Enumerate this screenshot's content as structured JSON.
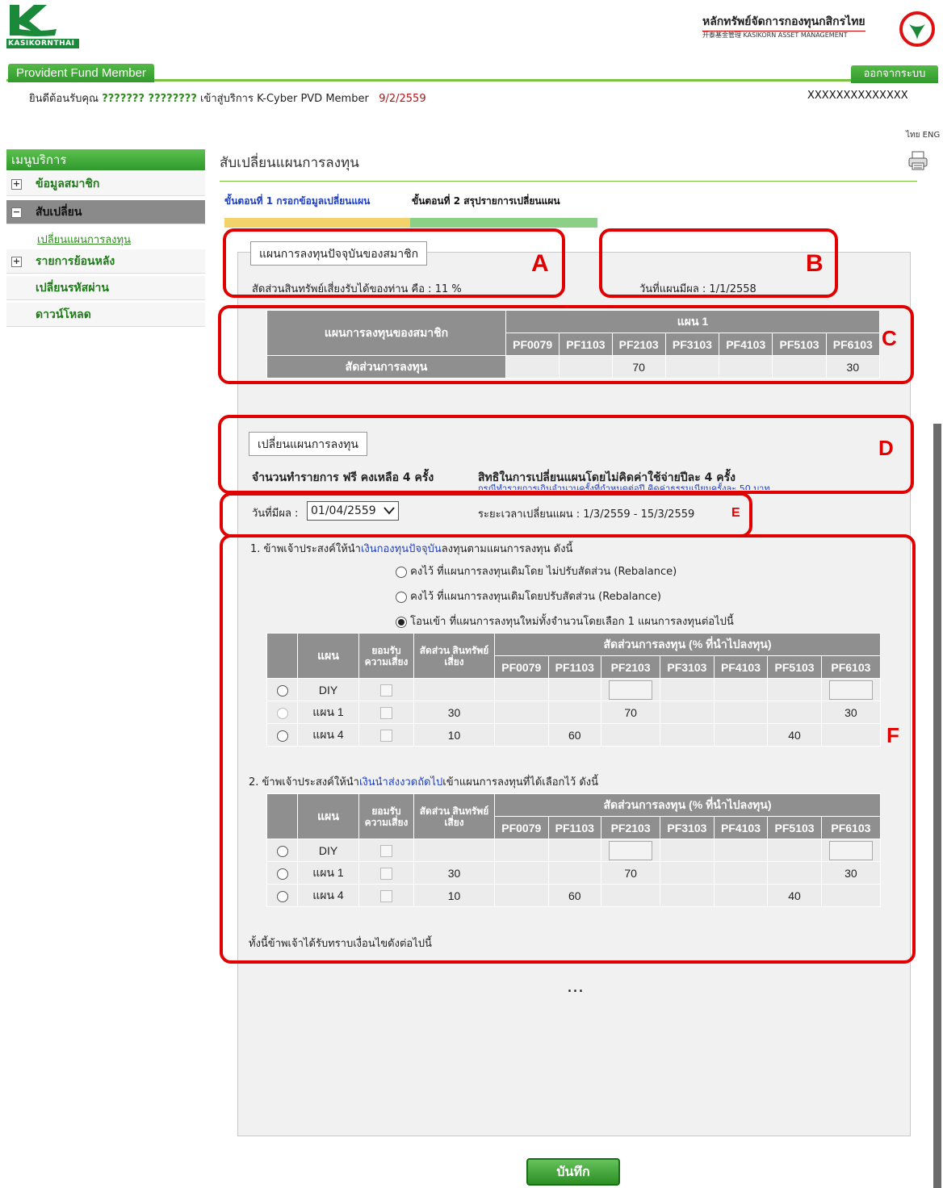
{
  "header": {
    "logo_text": "KASIKORNTHAI",
    "brand_th": "หลักทรัพย์จัดการกองทุนกสิกรไทย",
    "brand_en": "开泰基金管理 KASIKORN ASSET MANAGEMENT",
    "section_tab": "Provident Fund Member",
    "logout": "ออกจากระบบ",
    "welcome_prefix": "ยินดีต้อนรับคุณ",
    "welcome_name": "??????? ????????",
    "welcome_suffix": "เข้าสู่บริการ K-Cyber PVD Member",
    "welcome_date": "9/2/2559",
    "account": "XXXXXXXXXXXXXX",
    "lang": "ไทย ENG"
  },
  "sidebar": {
    "title": "เมนูบริการ",
    "items": [
      {
        "label": "ข้อมูลสมาชิก",
        "toggle": "+"
      },
      {
        "label": "สับเปลี่ยน",
        "toggle": "−"
      },
      {
        "label": "รายการย้อนหลัง",
        "toggle": "+"
      },
      {
        "label": "เปลี่ยนรหัสผ่าน",
        "toggle": ""
      },
      {
        "label": "ดาวน์โหลด",
        "toggle": ""
      }
    ],
    "sub_item": "เปลี่ยนแผนการลงทุน"
  },
  "main": {
    "title": "สับเปลี่ยนแผนการลงทุน",
    "step1": "ขั้นตอนที่ 1 กรอกข้อมูลเปลี่ยนแผน",
    "step2": "ขั้นตอนที่ 2 สรุปรายการเปลี่ยนแผน",
    "current": {
      "legend": "แผนการลงทุนปัจจุบันของสมาชิก",
      "risk_label": "สัดส่วนสินทรัพย์เสี่ยงรับได้ของท่าน คือ  :  11 %",
      "effective": "วันที่แผนมีผล :  1/1/2558",
      "table": {
        "row1": "แผนการลงทุนของสมาชิก",
        "row2": "สัดส่วนการลงทุน",
        "plan": "แผน 1",
        "funds": [
          "PF0079",
          "PF1103",
          "PF2103",
          "PF3103",
          "PF4103",
          "PF5103",
          "PF6103"
        ],
        "values": [
          "",
          "",
          "70",
          "",
          "",
          "",
          "30"
        ]
      }
    },
    "change": {
      "legend": "เปลี่ยนแผนการลงทุน",
      "free": "จำนวนทำรายการ ฟรี คงเหลือ 4 ครั้ง",
      "rights": "สิทธิในการเปลี่ยนแผนโดยไม่คิดค่าใช้จ่ายปีละ 4  ครั้ง",
      "note": "กรณีทำรายการเกินจำนวนครั้งที่กำหนดต่อปี คิดค่าธรรมเนียมครั้งละ 50 บาท",
      "eff_label": "วันที่มีผล :",
      "eff_value": "01/04/2559",
      "period": "ระยะเวลาเปลี่ยนแผน : 1/3/2559 - 15/3/2559"
    },
    "q1": {
      "pre": "1. ข้าพเจ้าประสงค์ให้นำ",
      "link": "เงินกองทุนปัจจุบัน",
      "post": "ลงทุนตามแผนการลงทุน ดังนี้",
      "options": [
        "คงไว้ ที่แผนการลงทุนเดิมโดย ไม่ปรับสัดส่วน (Rebalance)",
        "คงไว้ ที่แผนการลงทุนเดิมโดยปรับสัดส่วน (Rebalance)",
        "โอนเข้า ที่แผนการลงทุนใหม่ทั้งจำนวนโดยเลือก 1 แผนการลงทุนต่อไปนี้"
      ]
    },
    "q2": {
      "pre": "2. ข้าพเจ้าประสงค์ให้นำ",
      "link": "เงินนำส่งงวดถัดไป",
      "post": "เข้าแผนการลงทุนที่ได้เลือกไว้ ดังนี้"
    },
    "plan_table": {
      "h_plan": "แผน",
      "h_accept": "ยอมรับ ความเสี่ยง",
      "h_ratio": "สัดส่วน สินทรัพย์เสี่ยง",
      "h_alloc": "สัดส่วนการลงทุน (% ที่นำไปลงทุน)",
      "rows": [
        {
          "plan": "DIY",
          "ratio": "",
          "vals": [
            "",
            "",
            "",
            "",
            "",
            "",
            ""
          ]
        },
        {
          "plan": "แผน 1",
          "ratio": "30",
          "vals": [
            "",
            "",
            "70",
            "",
            "",
            "",
            "30"
          ]
        },
        {
          "plan": "แผน 4",
          "ratio": "10",
          "vals": [
            "",
            "60",
            "",
            "",
            "",
            "40",
            ""
          ]
        }
      ]
    },
    "ack": "ทั้งนี้ข้าพเจ้าได้รับทราบเงื่อนไขดังต่อไปนี้",
    "ellipsis": "...",
    "save": "บันทึก"
  },
  "annotations": [
    "A",
    "B",
    "C",
    "D",
    "E",
    "F"
  ],
  "colors": {
    "accent": "#e00000",
    "brand": "#2f9a2c"
  }
}
